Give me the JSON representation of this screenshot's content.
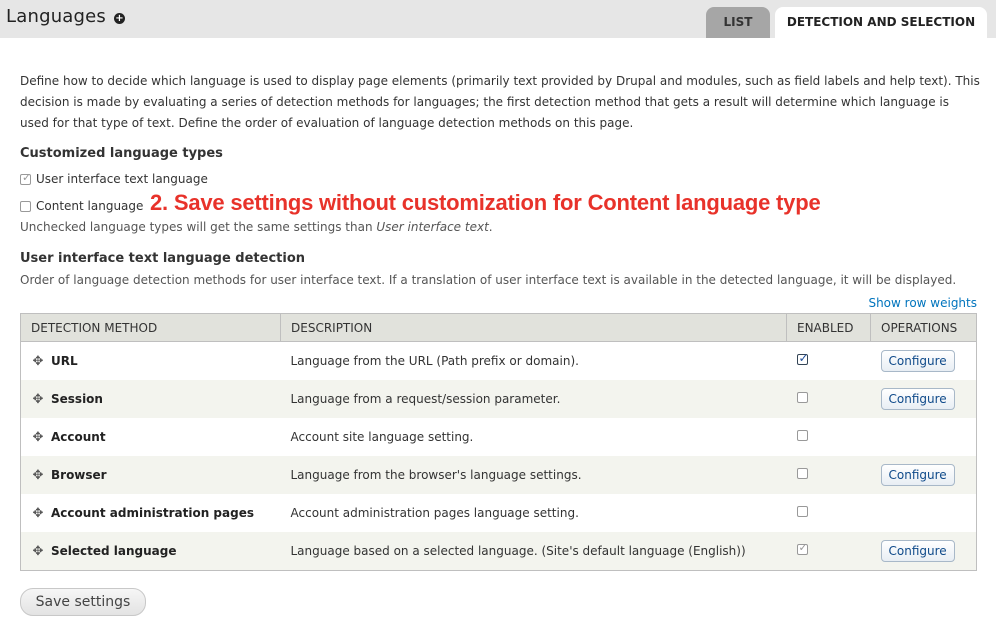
{
  "header": {
    "title": "Languages",
    "tabs": [
      {
        "label": "LIST"
      },
      {
        "label": "DETECTION AND SELECTION"
      }
    ]
  },
  "intro": "Define how to decide which language is used to display page elements (primarily text provided by Drupal and modules, such as field labels and help text). This decision is made by evaluating a series of detection methods for languages; the first detection method that gets a result will determine which language is used for that type of text. Define the order of evaluation of language detection methods on this page.",
  "customized": {
    "heading": "Customized language types",
    "options": [
      {
        "label": "User interface text language",
        "checked": true
      },
      {
        "label": "Content language",
        "checked": false
      }
    ],
    "help_prefix": "Unchecked language types will get the same settings than ",
    "help_em": "User interface text",
    "help_suffix": "."
  },
  "annotation": "2. Save settings without customization for Content language type",
  "detection": {
    "heading": "User interface text language detection",
    "description": "Order of language detection methods for user interface text. If a translation of user interface text is available in the detected language, it will be displayed.",
    "show_weights": "Show row weights",
    "columns": [
      "DETECTION METHOD",
      "DESCRIPTION",
      "ENABLED",
      "OPERATIONS"
    ],
    "rows": [
      {
        "name": "URL",
        "description": "Language from the URL (Path prefix or domain).",
        "enabled": true,
        "configure": "Configure"
      },
      {
        "name": "Session",
        "description": "Language from a request/session parameter.",
        "enabled": false,
        "configure": "Configure"
      },
      {
        "name": "Account",
        "description": "Account site language setting.",
        "enabled": false,
        "configure": ""
      },
      {
        "name": "Browser",
        "description": "Language from the browser's language settings.",
        "enabled": false,
        "configure": "Configure"
      },
      {
        "name": "Account administration pages",
        "description": "Account administration pages language setting.",
        "enabled": false,
        "configure": ""
      },
      {
        "name": "Selected language",
        "description": "Language based on a selected language. (Site's default language (English))",
        "enabled": true,
        "locked": true,
        "configure": "Configure"
      }
    ]
  },
  "save_label": "Save settings"
}
